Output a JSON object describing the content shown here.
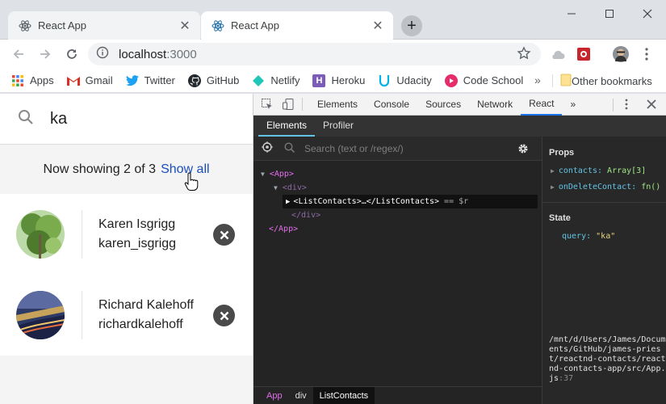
{
  "tabs": [
    {
      "title": "React App",
      "active": false
    },
    {
      "title": "React App",
      "active": true
    }
  ],
  "address": {
    "host": "localhost",
    "port": ":3000"
  },
  "bookmarks": [
    {
      "label": "Apps",
      "icon": "apps-icon"
    },
    {
      "label": "Gmail",
      "icon": "gmail-icon"
    },
    {
      "label": "Twitter",
      "icon": "twitter-icon"
    },
    {
      "label": "GitHub",
      "icon": "github-icon"
    },
    {
      "label": "Netlify",
      "icon": "netlify-icon"
    },
    {
      "label": "Heroku",
      "icon": "heroku-icon"
    },
    {
      "label": "Udacity",
      "icon": "udacity-icon"
    },
    {
      "label": "Code School",
      "icon": "codeschool-icon"
    }
  ],
  "bookmarks_more": "»",
  "other_bookmarks": "Other bookmarks",
  "app": {
    "query": "ka",
    "showing_text": "Now showing 2 of 3",
    "show_all": "Show all",
    "contacts": [
      {
        "name": "Karen Isgrigg",
        "handle": "karen_isgrigg"
      },
      {
        "name": "Richard Kalehoff",
        "handle": "richardkalehoff"
      }
    ]
  },
  "devtools": {
    "tabs": [
      "Elements",
      "Console",
      "Sources",
      "Network",
      "React"
    ],
    "active_tab": "React",
    "more": "»",
    "subtabs": [
      "Elements",
      "Profiler"
    ],
    "search_placeholder": "Search (text or /regex/)",
    "tree": {
      "app_open": "<App>",
      "div_open": "<div>",
      "selected": "<ListContacts>…</ListContacts>",
      "selected_suffix": "== $r",
      "div_close": "</div>",
      "app_close": "</App>"
    },
    "props_heading": "Props",
    "props": [
      {
        "key": "contacts",
        "value": "Array[3]"
      },
      {
        "key": "onDeleteContact",
        "value": "fn()"
      }
    ],
    "state_heading": "State",
    "state": [
      {
        "key": "query",
        "value": "\"ka\""
      }
    ],
    "source_path": "/mnt/d/Users/James/Documents/GitHub/james-priest/reactnd-contacts/reactnd-contacts-app/src/App.js",
    "source_line": ":37",
    "breadcrumbs": [
      "App",
      "div",
      "ListContacts"
    ]
  },
  "colors": {
    "link": "#1a4dbf",
    "react_tag": "#e36eec",
    "prop_key": "#62c4e5",
    "prop_value": "#a0e486"
  }
}
